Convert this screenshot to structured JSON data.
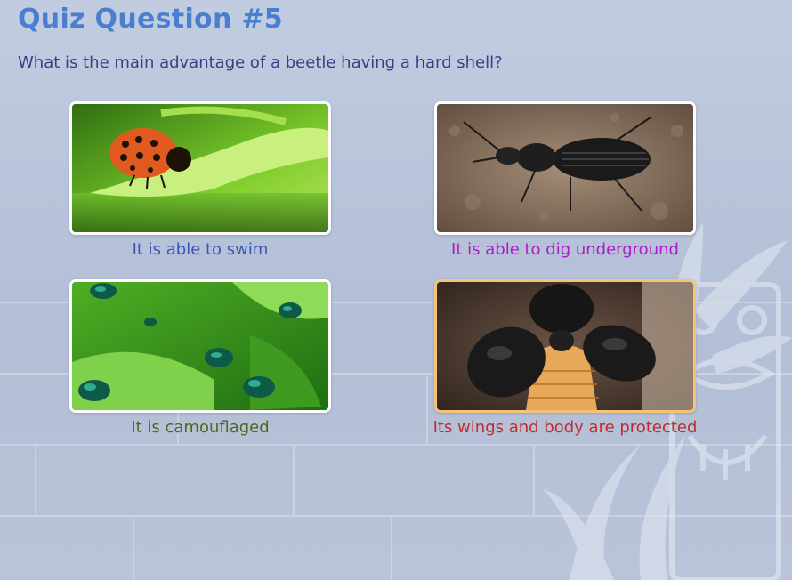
{
  "quiz": {
    "title": "Quiz Question #5",
    "question": "What is the main advantage of a beetle having a hard shell?"
  },
  "answers": [
    {
      "label": "It is able to swim",
      "color": "#3b55b4",
      "image_icon": "ladybug-on-leaf-photo",
      "selected": false
    },
    {
      "label": "It is able to dig underground",
      "color": "#b019c9",
      "image_icon": "ground-beetle-photo",
      "selected": false
    },
    {
      "label": "It is camouflaged",
      "color": "#4d6a1b",
      "image_icon": "green-beetles-photo",
      "selected": false
    },
    {
      "label": "Its wings and body are protected",
      "color": "#c32a2a",
      "image_icon": "beetle-wings-open-photo",
      "selected": true
    }
  ],
  "colors": {
    "title": "#4a7fd0",
    "question": "#3a3f86",
    "selected_border": "#f2c47a",
    "background": "#b7c3d9"
  }
}
